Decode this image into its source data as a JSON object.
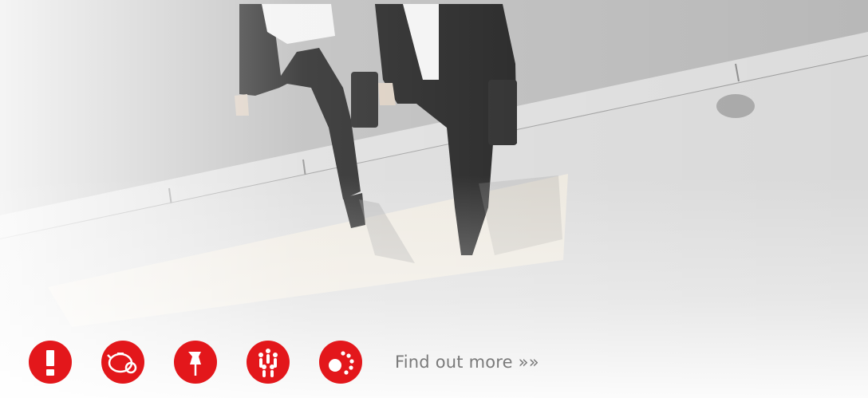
{
  "hero": {
    "image": "black-and-white-business-people-walking-photo"
  },
  "icons": [
    {
      "name": "alert-icon"
    },
    {
      "name": "piggy-bank-icon"
    },
    {
      "name": "pushpin-icon"
    },
    {
      "name": "people-group-icon"
    },
    {
      "name": "circle-dots-icon"
    }
  ],
  "accent_color": "#e3171b",
  "cta": {
    "label": "Find out more »»"
  }
}
